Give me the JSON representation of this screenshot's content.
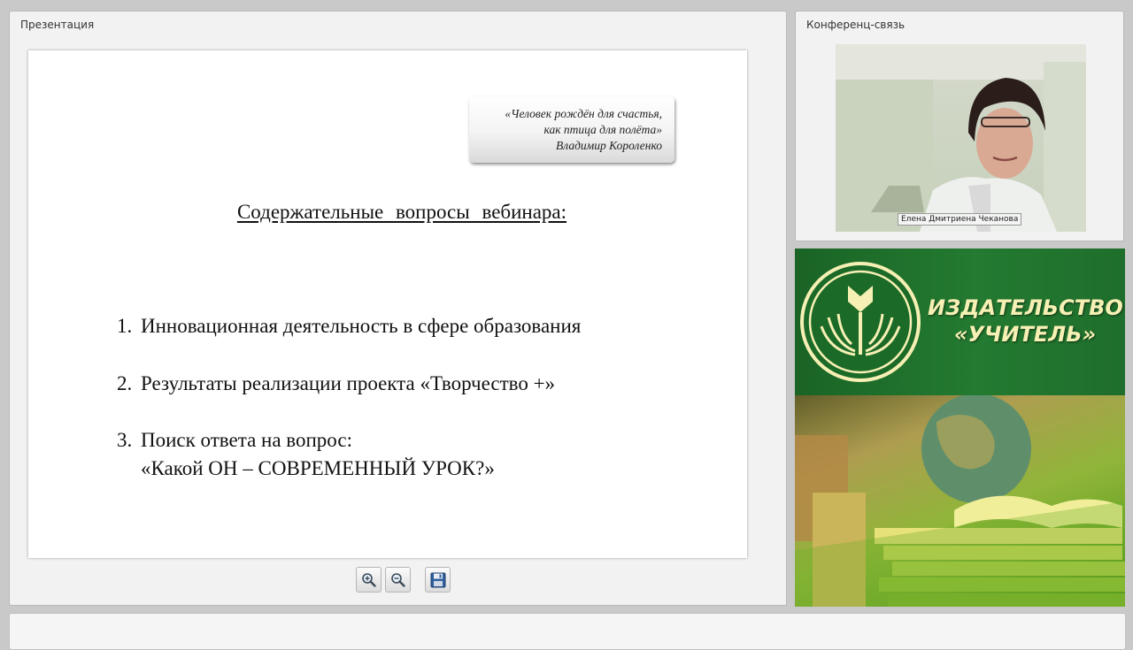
{
  "presentation": {
    "panel_title": "Презентация",
    "slide": {
      "quote": {
        "line1": "«Человек рождён для счастья,",
        "line2": "как птица для полёта»",
        "author": "Владимир Короленко"
      },
      "heading": "Содержательные вопросы вебинара:",
      "items": [
        {
          "number": "1.",
          "text": "Инновационная деятельность в сфере образования"
        },
        {
          "number": "2.",
          "text": "Результаты реализации  проекта «Творчество +»"
        },
        {
          "number": "3.",
          "text": "Поиск ответа на вопрос:",
          "text2": "«Какой ОН – СОВРЕМЕННЫЙ УРОК?»"
        }
      ]
    },
    "toolbar": {
      "buttons": [
        {
          "name": "zoom-in",
          "icon": "zoom-in-icon"
        },
        {
          "name": "zoom-out",
          "icon": "zoom-out-icon"
        },
        {
          "name": "save",
          "icon": "floppy-disk-icon"
        }
      ]
    }
  },
  "conference": {
    "panel_title": "Конференц-связь",
    "video": {
      "participant_name": "Елена Дмитриена Чеканова"
    }
  },
  "ad": {
    "publisher_line1": "ИЗДАТЕЛЬСТВО",
    "publisher_line2": "«УЧИТЕЛЬ»",
    "logo": "uchitel-logo",
    "colors": {
      "green": "#1e6a2a",
      "gold": "#f6f0b4"
    }
  }
}
